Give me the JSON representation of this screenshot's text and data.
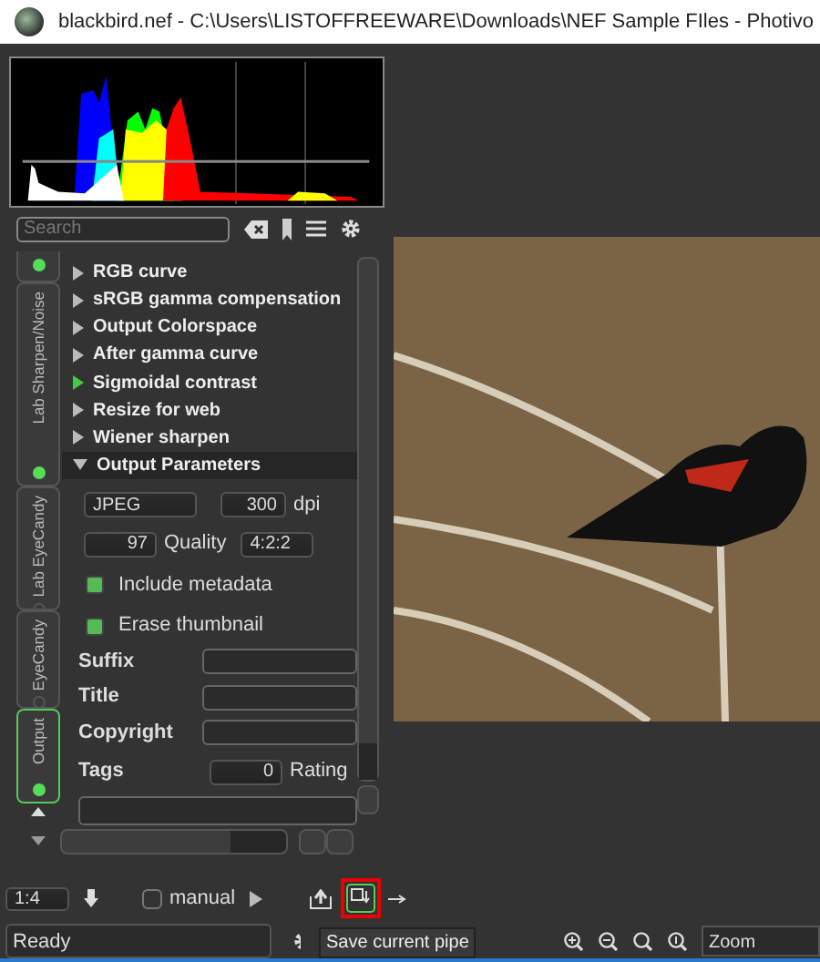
{
  "window": {
    "title": "blackbird.nef - C:\\Users\\LISTOFFREEWARE\\Downloads\\NEF Sample FIles - Photivo"
  },
  "search": {
    "placeholder": "Search"
  },
  "tabs": [
    {
      "label": "Lab Sharpen/Noise",
      "selected": false,
      "on": true
    },
    {
      "label": "Lab EyeCandy",
      "selected": false,
      "on": false
    },
    {
      "label": "EyeCandy",
      "selected": false,
      "on": false
    },
    {
      "label": "Output",
      "selected": true,
      "on": true
    }
  ],
  "modules": [
    {
      "name": "RGB curve",
      "enabled": false,
      "expanded": false
    },
    {
      "name": "sRGB gamma compensation",
      "enabled": false,
      "expanded": false
    },
    {
      "name": "Output Colorspace",
      "enabled": false,
      "expanded": false
    },
    {
      "name": "After gamma curve",
      "enabled": false,
      "expanded": false
    },
    {
      "name": "Sigmoidal contrast",
      "enabled": true,
      "expanded": false
    },
    {
      "name": "Resize for web",
      "enabled": false,
      "expanded": false
    },
    {
      "name": "Wiener sharpen",
      "enabled": false,
      "expanded": false
    },
    {
      "name": "Output Parameters",
      "enabled": false,
      "expanded": true
    }
  ],
  "output_parameters": {
    "format": "JPEG",
    "dpi": "300",
    "dpi_unit": "dpi",
    "quality": "97",
    "quality_label": "Quality",
    "sampling": "4:2:2",
    "checkboxes": [
      {
        "label": "Include metadata",
        "checked": true
      },
      {
        "label": "Erase thumbnail",
        "checked": true
      }
    ],
    "fields": [
      {
        "label": "Suffix"
      },
      {
        "label": "Title"
      },
      {
        "label": "Copyright"
      }
    ],
    "tags_label": "Tags",
    "rating": "0",
    "rating_label": "Rating"
  },
  "toolbar": {
    "scale": "1:4",
    "manual": {
      "label": "manual",
      "checked": false
    },
    "tooltip": "Save current pipe"
  },
  "status_bar": {
    "text": "Ready",
    "zoom": "Zoom"
  }
}
